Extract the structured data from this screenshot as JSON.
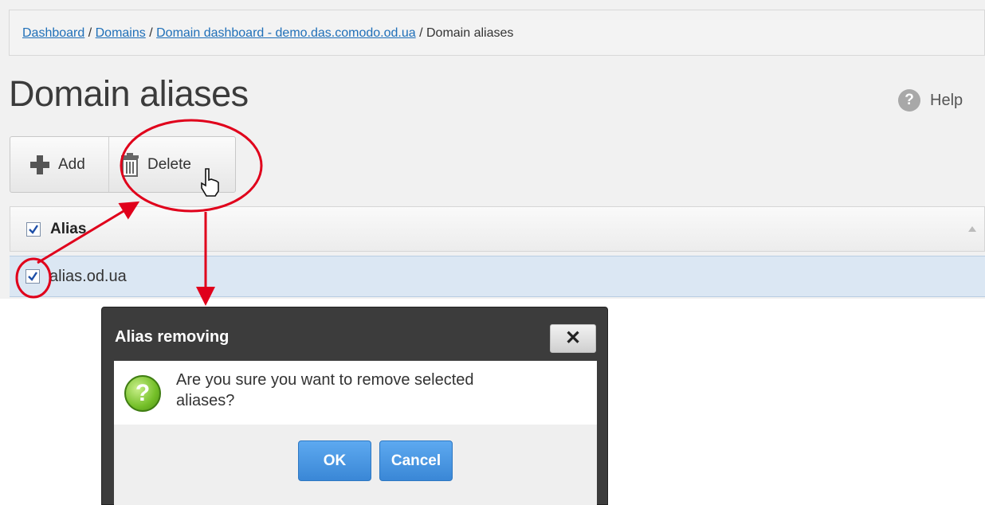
{
  "breadcrumb": {
    "dashboard": "Dashboard",
    "domains": "Domains",
    "domain_dashboard": "Domain dashboard - demo.das.comodo.od.ua",
    "current": "Domain aliases",
    "separator": " / "
  },
  "page": {
    "title": "Domain aliases",
    "help_label": "Help"
  },
  "toolbar": {
    "add_label": "Add",
    "delete_label": "Delete"
  },
  "grid": {
    "header_alias": "Alias",
    "rows": [
      {
        "alias": "alias.od.ua",
        "checked": true
      }
    ],
    "select_all_checked": true
  },
  "dialog": {
    "title": "Alias removing",
    "close_glyph": "✕",
    "message": "Are you sure you want to remove selected aliases?",
    "ok_label": "OK",
    "cancel_label": "Cancel"
  },
  "colors": {
    "annotation": "#e0001b",
    "link": "#1f6fb8",
    "primary_button": "#3a87d6",
    "selected_row": "#dbe7f3"
  }
}
